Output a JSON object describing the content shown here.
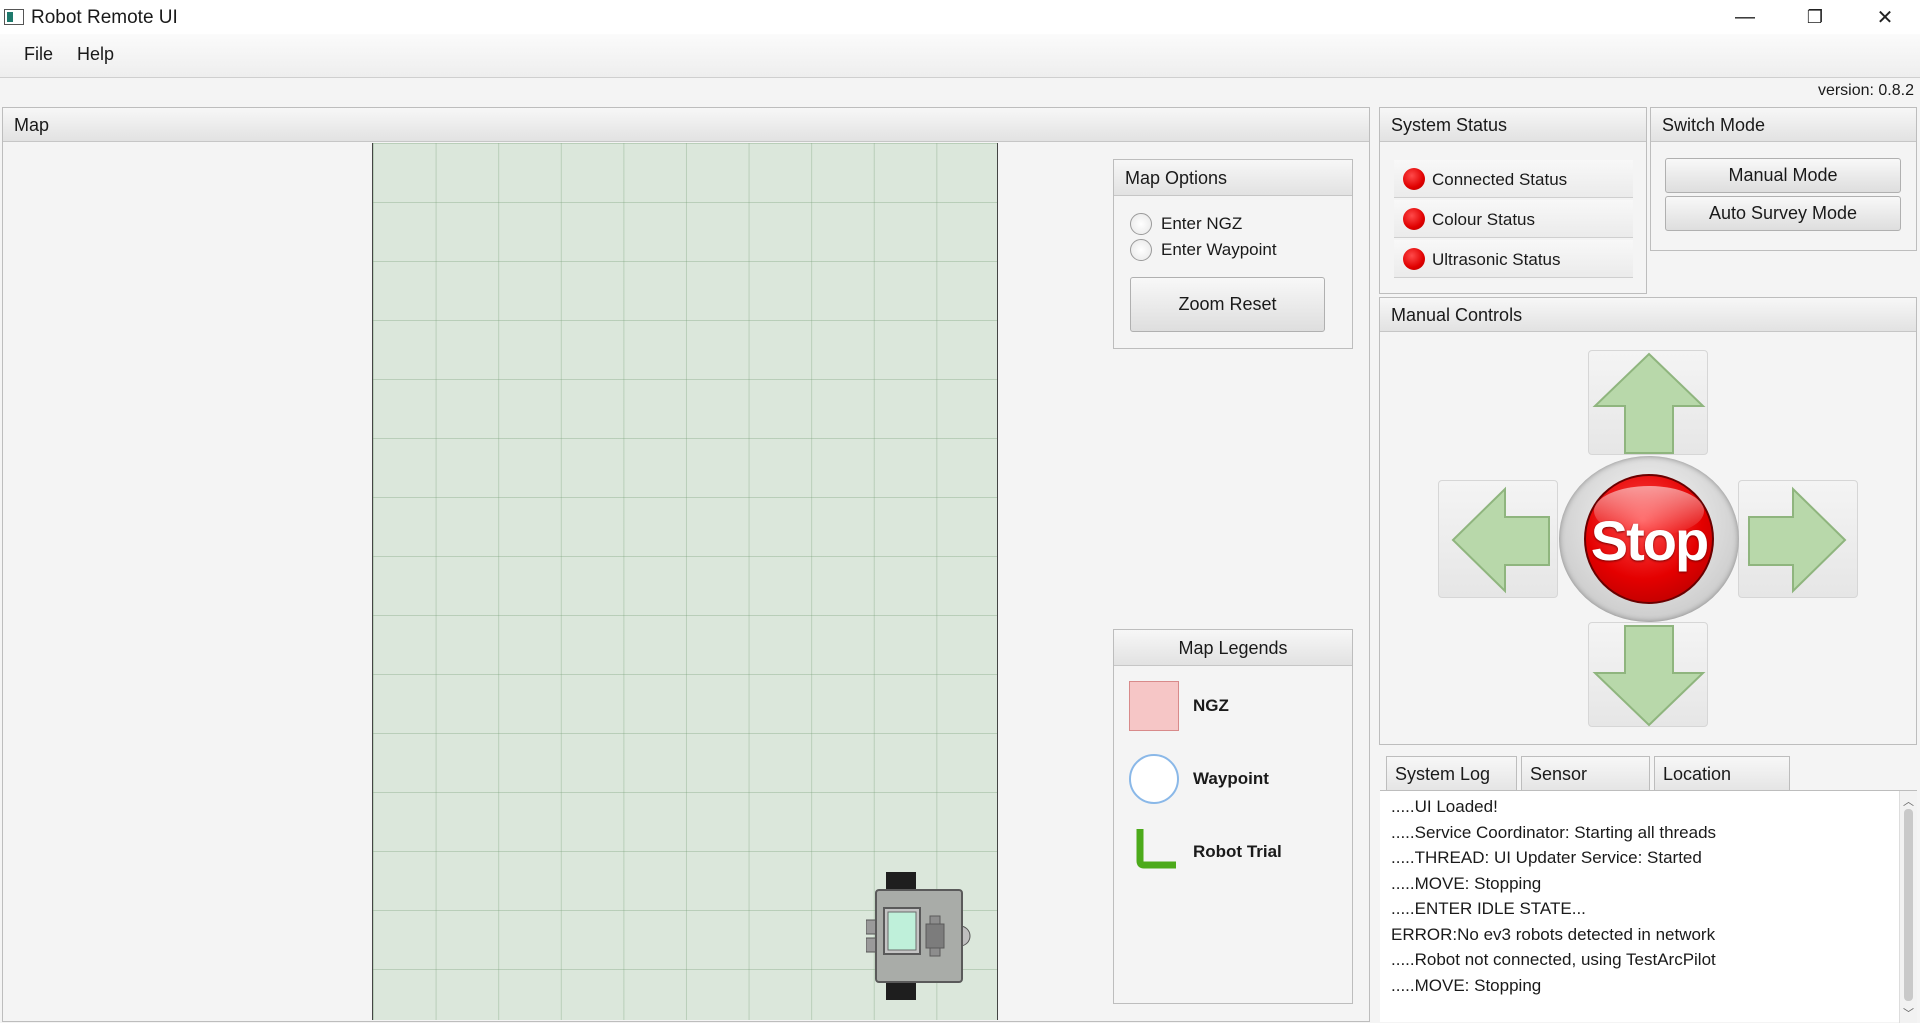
{
  "window": {
    "title": "Robot Remote UI",
    "minimize_icon": "—",
    "restore_icon": "❐",
    "close_icon": "✕"
  },
  "menu": {
    "file": "File",
    "help": "Help"
  },
  "version": "version: 0.8.2",
  "map_panel": {
    "title": "Map"
  },
  "map_options": {
    "title": "Map Options",
    "enter_ngz": "Enter NGZ",
    "enter_waypoint": "Enter Waypoint",
    "zoom_reset": "Zoom Reset"
  },
  "map_legends": {
    "title": "Map Legends",
    "ngz": "NGZ",
    "waypoint": "Waypoint",
    "robot_trial": "Robot Trial"
  },
  "system_status": {
    "title": "System Status",
    "items": [
      "Connected Status",
      "Colour Status",
      "Ultrasonic Status"
    ],
    "led_color": "#e00000"
  },
  "switch_mode": {
    "title": "Switch Mode",
    "manual": "Manual Mode",
    "auto": "Auto Survey Mode"
  },
  "manual_controls": {
    "title": "Manual Controls",
    "stop_label": "Stop",
    "arrow_color": "#b5d6a7"
  },
  "tabs": {
    "system_log": "System Log",
    "close_icon": "✕",
    "sensor_graphs": "Sensor Graphs",
    "location_status": "Location Status"
  },
  "log": [
    ".....UI Loaded!",
    ".....Service Coordinator: Starting all threads",
    ".....THREAD: UI Updater Service: Started",
    ".....MOVE: Stopping",
    ".....ENTER IDLE STATE...",
    "ERROR:No ev3 robots detected in network",
    ".....Robot not connected, using TestArcPilot",
    ".....MOVE: Stopping"
  ]
}
